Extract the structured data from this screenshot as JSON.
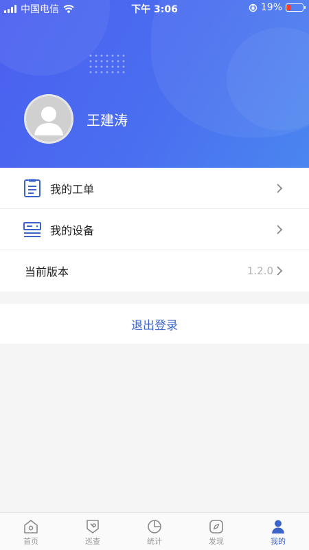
{
  "status_bar": {
    "carrier": "中国电信",
    "time": "下午 3:06",
    "battery_percent": "19%",
    "battery_level": 0.19
  },
  "profile": {
    "user_name": "王建涛"
  },
  "menu": {
    "items": [
      {
        "label": "我的工单",
        "icon": "work-order-icon"
      },
      {
        "label": "我的设备",
        "icon": "device-icon"
      },
      {
        "label": "当前版本",
        "value": "1.2.0"
      }
    ]
  },
  "logout_label": "退出登录",
  "tabbar": {
    "active_index": 4,
    "accent_color": "#3b63c8",
    "tabs": [
      {
        "label": "首页",
        "icon": "home-icon"
      },
      {
        "label": "巡查",
        "icon": "inspection-icon"
      },
      {
        "label": "统计",
        "icon": "pie-chart-icon"
      },
      {
        "label": "发现",
        "icon": "compass-icon"
      },
      {
        "label": "我的",
        "icon": "user-icon"
      }
    ]
  },
  "colors": {
    "header_gradient_start": "#4b5ff0",
    "header_gradient_end": "#4a86f0",
    "link_blue": "#3b63c8"
  }
}
